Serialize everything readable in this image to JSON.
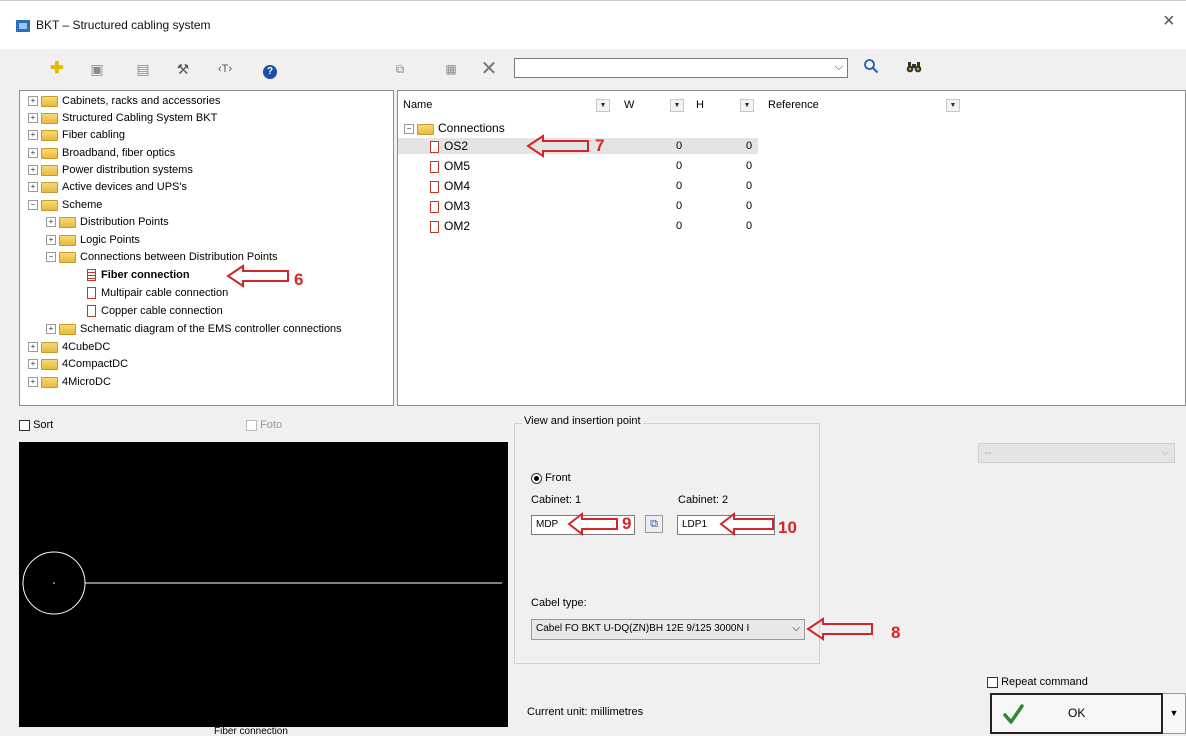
{
  "window": {
    "title": "BKT – Structured cabling system",
    "close_glyph": "×"
  },
  "toolbar": {
    "left_icons": [
      "add-icon",
      "insert-icon",
      "list-icon",
      "tools-icon",
      "text-icon",
      "help-icon"
    ],
    "right_icons": [
      "copy-icon",
      "table-icon",
      "delete-icon"
    ],
    "search_value": "",
    "search_icons": [
      "magnifier-icon",
      "binoculars-icon"
    ]
  },
  "tree": {
    "items": [
      {
        "label": "Cabinets, racks and accessories"
      },
      {
        "label": "Structured Cabling System BKT"
      },
      {
        "label": "Fiber cabling"
      },
      {
        "label": "Broadband, fiber optics"
      },
      {
        "label": "Power distribution systems"
      },
      {
        "label": "Active devices and UPS's"
      },
      {
        "label": "Scheme"
      },
      {
        "label": "Distribution Points"
      },
      {
        "label": "Logic Points"
      },
      {
        "label": "Connections between Distribution Points"
      },
      {
        "label": "Fiber connection"
      },
      {
        "label": "Multipair cable connection"
      },
      {
        "label": "Copper cable connection"
      },
      {
        "label": "Schematic diagram of the EMS controller connections"
      },
      {
        "label": "4CubeDC"
      },
      {
        "label": "4CompactDC"
      },
      {
        "label": "4MicroDC"
      }
    ]
  },
  "table": {
    "columns": [
      "Name",
      "W",
      "H",
      "Reference"
    ],
    "group": "Connections",
    "rows": [
      {
        "name": "OS2",
        "w": "0",
        "h": "0"
      },
      {
        "name": "OM5",
        "w": "0",
        "h": "0"
      },
      {
        "name": "OM4",
        "w": "0",
        "h": "0"
      },
      {
        "name": "OM3",
        "w": "0",
        "h": "0"
      },
      {
        "name": "OM2",
        "w": "0",
        "h": "0"
      }
    ]
  },
  "options": {
    "sort_label": "Sort",
    "foto_label": "Foto"
  },
  "preview": {
    "caption": "Fiber connection"
  },
  "view": {
    "group_title": "View and insertion point",
    "front_label": "Front",
    "cabinet1_label": "Cabinet: 1",
    "cabinet1_value": "MDP",
    "cabinet2_label": "Cabinet: 2",
    "cabinet2_value": "LDP1",
    "cable_type_label": "Cabel type:",
    "cable_type_value": "Cabel FO BKT U-DQ(ZN)BH 12E 9/125 3000N I"
  },
  "right_dropdown": {
    "value": "--"
  },
  "unit_text": "Current unit: millimetres",
  "repeat_label": "Repeat command",
  "ok_label": "OK",
  "annotations": {
    "a6": "6",
    "a7": "7",
    "a8": "8",
    "a9": "9",
    "a10": "10"
  },
  "colors": {
    "annotation": "#d42626",
    "preview_bg": "#000000",
    "preview_line": "#ffffff"
  }
}
